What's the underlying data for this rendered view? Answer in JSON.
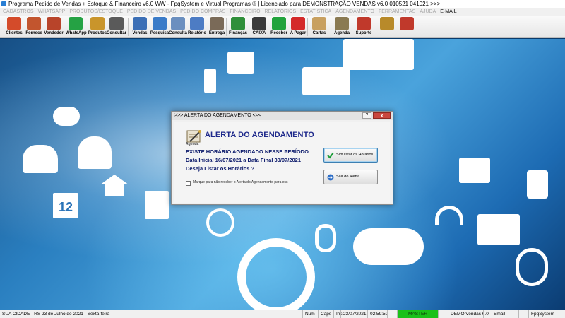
{
  "window": {
    "title": "Programa Pedido de Vendas + Estoque & Financeiro v6.0 WW - FpqSystem e Virtual Programas ® | Licenciado para  DEMONSTRAÇÃO VENDAS v6.0 010521 041021 >>>"
  },
  "menu": {
    "items": [
      "CADASTROS",
      "WHATSAPP",
      "PRODUTOS/ESTOQUE",
      "PEDIDO DE VENDAS",
      "PEDIDO COMPRAS",
      "FINANCEIRO",
      "RELATÓRIOS",
      "ESTATÍSTICA",
      "AGENDAMENTO",
      "FERRAMENTAS",
      "AJUDA",
      "E-MAIL"
    ]
  },
  "toolbar": {
    "buttons": [
      {
        "label": "Clientes",
        "icon": "people-icon",
        "color": "#d44b2a"
      },
      {
        "label": "Fornece",
        "icon": "supplier-icon",
        "color": "#c2552e"
      },
      {
        "label": "Vendedor",
        "icon": "seller-icon",
        "color": "#b8442a"
      },
      {
        "label": "WhatsApp",
        "icon": "whatsapp-icon",
        "color": "#25a244"
      },
      {
        "label": "Produtos",
        "icon": "products-icon",
        "color": "#c9952b"
      },
      {
        "label": "Consultar",
        "icon": "search-stock-icon",
        "color": "#5a5a5a"
      },
      {
        "label": "Vendas",
        "icon": "sales-icon",
        "color": "#3c6fb6"
      },
      {
        "label": "Pesquisa",
        "icon": "search-sales-icon",
        "color": "#3a7bc8"
      },
      {
        "label": "Consulta",
        "icon": "consult-icon",
        "color": "#6b8fbf"
      },
      {
        "label": "Relatório",
        "icon": "report-icon",
        "color": "#4d7cc4"
      },
      {
        "label": "Entrega",
        "icon": "delivery-icon",
        "color": "#7a6a58"
      },
      {
        "label": "Finanças",
        "icon": "finance-icon",
        "color": "#2f8f3a"
      },
      {
        "label": "CAIXA",
        "icon": "cashbox-icon",
        "color": "#3a3a3a"
      },
      {
        "label": "Receber",
        "icon": "receive-icon",
        "color": "#22a33c"
      },
      {
        "label": "A Pagar",
        "icon": "pay-icon",
        "color": "#d42a2a"
      },
      {
        "label": "Cartas",
        "icon": "letters-icon",
        "color": "#c8a060"
      },
      {
        "label": "Agenda",
        "icon": "agenda-icon",
        "color": "#8a7a52"
      },
      {
        "label": "Suporte",
        "icon": "support-icon",
        "color": "#c0392b"
      },
      {
        "label": "",
        "icon": "backup-icon",
        "color": "#b88a2a"
      },
      {
        "label": "",
        "icon": "exit-icon",
        "color": "#c0392b"
      }
    ]
  },
  "dialog": {
    "title": ">>> ALERTA DO AGENDAMENTO <<<",
    "help": "?",
    "close": "x",
    "icon_label": "Agenda",
    "heading": "ALERTA DO AGENDAMENTO",
    "line1": "EXISTE HORÁRIO AGENDADO NESSE PERÍODO:",
    "line2": "Data Inicial 16/07/2021 a Data Final 30/07/2021",
    "line3": "Deseja Listar os Horários ?",
    "checkbox_label": "Marque para não receber o Alerta do Agendamento para ess",
    "btn_list": "Sim listar os Horários",
    "btn_exit": "Sair do Alerta"
  },
  "statusbar": {
    "city": "SUA CIDADE - RS 23 de Julho de 2021 - Sexta-feira",
    "num": "Num",
    "caps": "Caps",
    "ins": "Ins",
    "date": "23/07/2021",
    "time": "02:59:59",
    "master": "MASTER",
    "version": "DEMO Vendas 6.0",
    "email": "Email",
    "company": "FpqSystem"
  },
  "desktop": {
    "calendar_number": "12"
  }
}
